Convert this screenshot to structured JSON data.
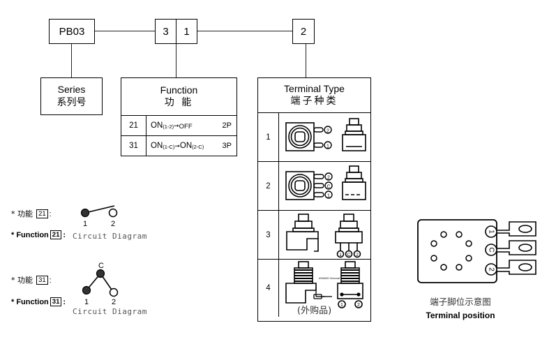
{
  "part_code": {
    "series_code": "PB03",
    "function_code_digits": [
      "3",
      "1"
    ],
    "terminal_code": "2"
  },
  "series_block": {
    "label_en": "Series",
    "label_cn": "系列号"
  },
  "function_table": {
    "header_en": "Function",
    "header_cn": "功 能",
    "rows": [
      {
        "code": "21",
        "on_a": "ON",
        "sub_a": "(1-2)",
        "arrow": "➞",
        "on_b": "OFF",
        "sub_b": "",
        "poles": "2P"
      },
      {
        "code": "31",
        "on_a": "ON",
        "sub_a": "(1-C)",
        "arrow": "➞",
        "on_b": "ON",
        "sub_b": "(2-C)",
        "poles": "3P"
      }
    ]
  },
  "terminal_table": {
    "header_en": "Terminal Type",
    "header_cn": "端子种类",
    "rows": [
      {
        "code": "1",
        "pin_labels": [
          "2",
          "1"
        ],
        "note": ""
      },
      {
        "code": "2",
        "pin_labels": [
          "2",
          "C",
          "1"
        ],
        "note": ""
      },
      {
        "code": "3",
        "pin_labels": [
          "1",
          "C",
          "2"
        ],
        "note": ""
      },
      {
        "code": "4",
        "pin_labels": [
          "1",
          "2"
        ],
        "note": "(外购品)",
        "wire_label": "#20AWG Overcoat"
      }
    ]
  },
  "circuit_notes": [
    {
      "cn_prefix": "* 功能",
      "en_prefix": "* Function",
      "code": "21",
      "colon": ":",
      "caption": "Circuit Diagram",
      "contact_labels": [
        "1",
        "2"
      ]
    },
    {
      "cn_prefix": "* 功能",
      "en_prefix": "* Function",
      "code": "31",
      "colon": ":",
      "caption": "Circuit Diagram",
      "contact_labels": [
        "1",
        "2"
      ],
      "common_label": "C"
    }
  ],
  "terminal_position": {
    "caption_cn": "端子脚位示意图",
    "caption_en": "Terminal position",
    "blade_labels": [
      "1",
      "C",
      "2"
    ]
  },
  "colors": {
    "line": "#222222",
    "ink": "#000000",
    "muted": "#555555"
  }
}
